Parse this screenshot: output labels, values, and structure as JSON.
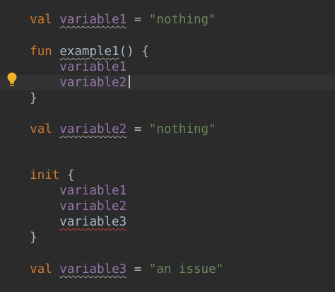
{
  "code": {
    "l1": {
      "kw": "val",
      "name": "variable1",
      "eq": "=",
      "str": "\"nothing\""
    },
    "l2": {
      "kw": "fun",
      "name": "example1",
      "rest": "() {"
    },
    "l3": {
      "name": "variable1"
    },
    "l4": {
      "name": "variable2"
    },
    "l5": {
      "brace": "}"
    },
    "l6": {
      "kw": "val",
      "name": "variable2",
      "eq": "=",
      "str": "\"nothing\""
    },
    "l7": {
      "kw": "init",
      "rest": "{"
    },
    "l8": {
      "name": "variable1"
    },
    "l9": {
      "name": "variable2"
    },
    "l10": {
      "name": "variable3"
    },
    "l11": {
      "brace": "}"
    },
    "l12": {
      "kw": "val",
      "name": "variable3",
      "eq": "=",
      "str": "\"an issue\""
    }
  },
  "gutter": {
    "icon": "lightbulb-icon"
  },
  "colors": {
    "background": "#2b2b2b",
    "keyword": "#cc7832",
    "property": "#9876aa",
    "string": "#6a8759",
    "text": "#a9b7c6",
    "bulb": "#f0b429"
  }
}
